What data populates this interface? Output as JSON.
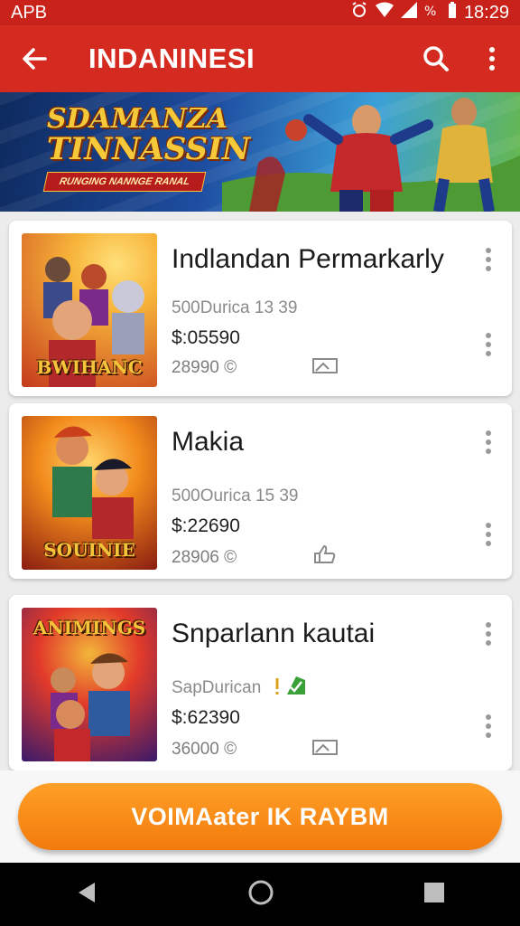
{
  "status_bar": {
    "carrier": "APB",
    "time": "18:29"
  },
  "app_bar": {
    "title": "INDANINESI"
  },
  "banner": {
    "logo_line1": "SDAMANZA",
    "logo_line2": "TINNASSIN",
    "tagline": "RUNGING NANNGE RANAL"
  },
  "items": [
    {
      "name": "Indlandan Permarkarly",
      "meta": "500Durica 13 39",
      "price": "$:05590",
      "stat": "28990 ©",
      "thumb_caption": "BWIHANC",
      "thumb_colors": [
        "#f7b43a",
        "#c43a1c"
      ]
    },
    {
      "name": "Makia",
      "meta": "500Ourica 15 39",
      "price": "$:22690",
      "stat": "28906 ©",
      "thumb_caption": "SOUINIE",
      "thumb_colors": [
        "#f28a1c",
        "#8a1c10"
      ]
    },
    {
      "name": "Snparlann kautai",
      "meta": "SapDurican",
      "price": "$:62390",
      "stat": "36000 ©",
      "thumb_caption": "ANIMINGS",
      "thumb_colors": [
        "#6a2a8a",
        "#e23a2a"
      ]
    }
  ],
  "cta": {
    "label": "VOIMAater IK RAYBM"
  },
  "colors": {
    "primary": "#d42a1f",
    "accent": "#f27a0c"
  }
}
